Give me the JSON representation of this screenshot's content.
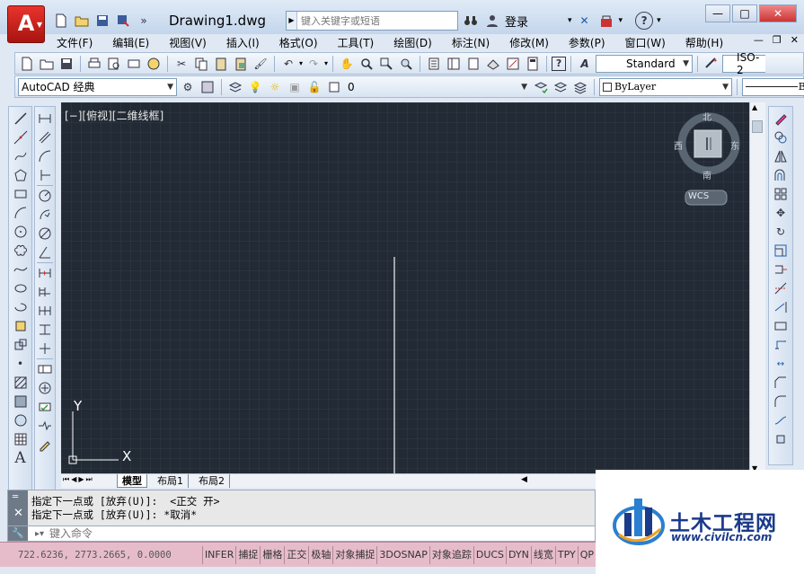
{
  "app": {
    "logo_letter": "A",
    "doc_title": "Drawing1.dwg",
    "search_placeholder": "键入关键字或短语",
    "login_label": "登录",
    "help_label": "?",
    "overflow_label": "»"
  },
  "menubar": [
    "文件(F)",
    "编辑(E)",
    "视图(V)",
    "插入(I)",
    "格式(O)",
    "工具(T)",
    "绘图(D)",
    "标注(N)",
    "修改(M)",
    "参数(P)",
    "窗口(W)",
    "帮助(H)"
  ],
  "toolbar": {
    "text_style": "Standard",
    "dim_style": "ISO-2",
    "workspace": "AutoCAD 经典",
    "layer": "0",
    "color": "ByLayer",
    "linetype_label": "By"
  },
  "canvas": {
    "view_label": "[−][俯视][二维线框]",
    "viewcube": {
      "north": "北",
      "south": "南",
      "east": "东",
      "west": "西",
      "wcs": "WCS"
    },
    "ucs": {
      "x": "X",
      "y": "Y"
    }
  },
  "tabs": [
    "模型",
    "布局1",
    "布局2"
  ],
  "command": {
    "lines": [
      "指定下一点或 [放弃(U)]:  <正交 开>",
      "指定下一点或 [放弃(U)]: *取消*"
    ],
    "placeholder": "键入命令"
  },
  "status": {
    "coords": "722.6236,  2773.2665, 0.0000",
    "buttons": [
      "INFER",
      "捕捉",
      "栅格",
      "正交",
      "极轴",
      "对象捕捉",
      "3DOSNAP",
      "对象追踪",
      "DUCS",
      "DYN",
      "线宽",
      "TPY",
      "QP"
    ]
  },
  "watermark": {
    "title": "土木工程网",
    "url": "www.civilcn.com"
  },
  "colors": {
    "canvas_bg": "#222a35",
    "app_red": "#d42a22",
    "status_bg": "#e6bccb",
    "watermark_blue": "#1a3a8a"
  }
}
